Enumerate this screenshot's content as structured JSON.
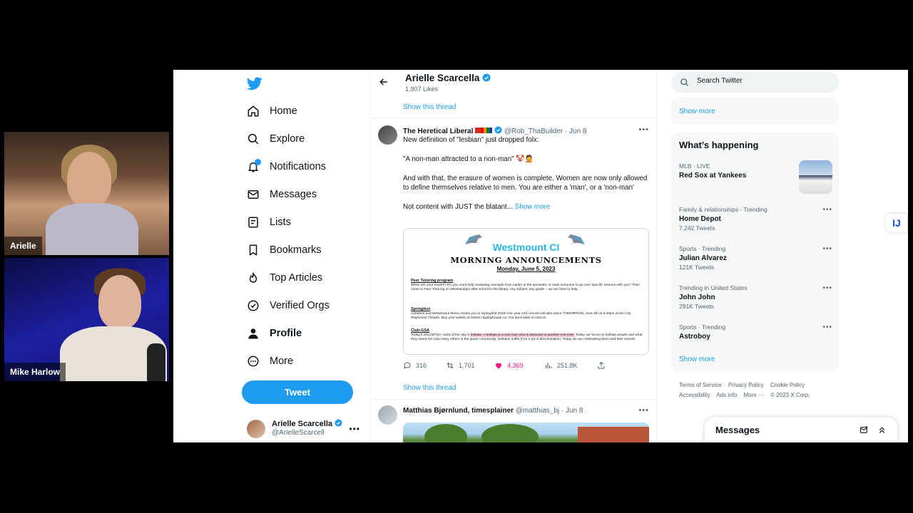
{
  "webcams": [
    {
      "name": "Arielle"
    },
    {
      "name": "Mike Harlow"
    }
  ],
  "nav": {
    "items": [
      {
        "label": "Home",
        "icon": "home-icon"
      },
      {
        "label": "Explore",
        "icon": "search-icon"
      },
      {
        "label": "Notifications",
        "icon": "bell-icon"
      },
      {
        "label": "Messages",
        "icon": "envelope-icon"
      },
      {
        "label": "Lists",
        "icon": "list-icon"
      },
      {
        "label": "Bookmarks",
        "icon": "bookmark-icon"
      },
      {
        "label": "Top Articles",
        "icon": "flame-icon"
      },
      {
        "label": "Verified Orgs",
        "icon": "verified-icon"
      },
      {
        "label": "Profile",
        "icon": "person-icon"
      },
      {
        "label": "More",
        "icon": "more-circle-icon"
      }
    ],
    "tweet_button": "Tweet",
    "account": {
      "name": "Arielle Scarcella",
      "handle": "@ArielleScarcell"
    }
  },
  "header": {
    "name": "Arielle Scarcella",
    "likes": "1,907 Likes"
  },
  "show_thread": "Show this thread",
  "tweet1": {
    "author": "The Heretical Liberal",
    "handle": "@Rob_ThaBuilder",
    "date": "Jun 8",
    "p1": "New definition of \"lesbian\" just dropped folx:",
    "p2": "\"A non-man attracted to a non-man\" 🤡🤦",
    "p3": "And with that, the erasure of women is complete. Women are now only allowed to define themselves relative to men. You are either a 'man', or a 'non-man'",
    "p4": "Not content with JUST the blatant...",
    "show_more": "Show more",
    "card": {
      "title": "Westmount CI",
      "subtitle": "Morning Announcements",
      "date": "Monday, June 5, 2023",
      "s1_head": "Peer Tutoring program",
      "s1_text": "When are your exams? Do you need help reviewing concepts from earlier in the semester, or want someone to go over specific lessons with you? Then come to Peer Tutoring on Wednesdays after school in the library. Any subject, any grade – we are here to help.",
      "s2_head": "Springfest",
      "s2_text": "ArtsWest and Westmount Music invites you to Springfest 2023! Our year end concert will take place TOMORROW, June 6th at 6:30pm at the City Playhouse Theatre. Buy your tickets at tickets.cityplayhouse.ca. You don't want to miss it!",
      "s3_head": "Club-GSA",
      "s3_text_a": "Today's 2SLGBTQI+ word of the day is ",
      "s3_hl1": "lesbian. A lesbian is a non-man who is attracted to another non-man.",
      "s3_text_b": " Today, we focus on lesbian people and what they stand for! Like many others in the queer community, lesbians suffer from a lot of discrimination. Today we are celebrating them and their stories!"
    },
    "replies": "316",
    "retweets": "1,701",
    "likes": "4,369",
    "views": "251.8K"
  },
  "tweet2": {
    "author": "Matthias Bjørnlund, timesplainer",
    "handle": "@matthias_bj",
    "date": "Jun 8"
  },
  "search": {
    "placeholder": "Search Twitter"
  },
  "right": {
    "show_more": "Show more",
    "whats_happening": "What’s happening",
    "trends": [
      {
        "context": "MLB · LIVE",
        "name": "Red Sox at Yankees",
        "count": ""
      },
      {
        "context": "Family & relationships · Trending",
        "name": "Home Depot",
        "count": "7,242 Tweets"
      },
      {
        "context": "Sports · Trending",
        "name": "Julian Alvarez",
        "count": "121K Tweets"
      },
      {
        "context": "Trending in United States",
        "name": "John John",
        "count": "291K Tweets"
      },
      {
        "context": "Sports · Trending",
        "name": "Astroboy",
        "count": ""
      }
    ],
    "footer": [
      "Terms of Service",
      "Privacy Policy",
      "Cookie Policy",
      "Accessibility",
      "Ads info",
      "More ···",
      "© 2023 X Corp."
    ]
  },
  "messages_drawer": {
    "title": "Messages"
  },
  "colors": {
    "accent": "#1d9bf0",
    "like": "#f91880",
    "text": "#0f1419",
    "muted": "#536471"
  }
}
